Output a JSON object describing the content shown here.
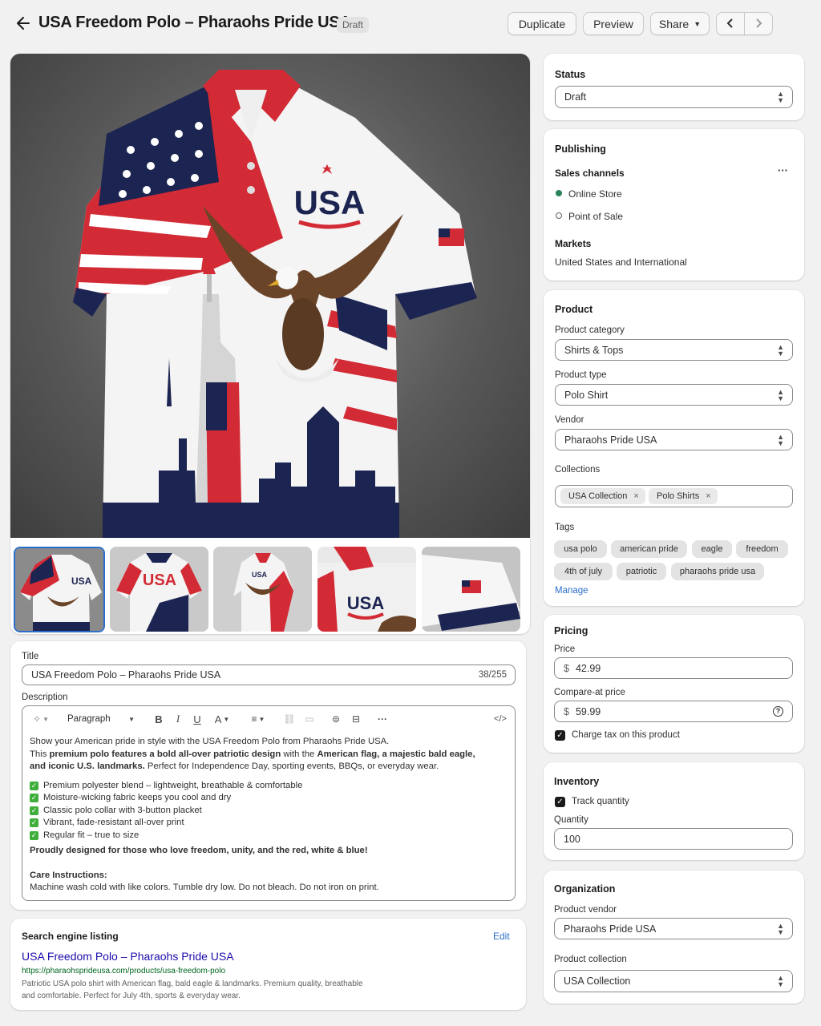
{
  "header": {
    "title": "USA Freedom Polo – Pharaohs Pride USA",
    "badge": "Draft",
    "duplicate": "Duplicate",
    "preview": "Preview",
    "share": "Share"
  },
  "gallery": {
    "alt": "USA"
  },
  "title_field": {
    "label": "Title",
    "value": "USA Freedom Polo – Pharaohs Pride USA",
    "counter": "38/255"
  },
  "description": {
    "label": "Description",
    "format": "Paragraph",
    "intro": "Show your American pride in style with the USA Freedom Polo from Pharaohs Pride USA.",
    "l2a": "This ",
    "l2b": "premium polo features a bold all-over patriotic design",
    "l2c": " with the ",
    "l2d": "American flag, a majestic bald eagle,",
    "l3a": "and iconic U.S. landmarks.",
    "l3b": " Perfect for Independence Day, sporting events, BBQs, or everyday wear.",
    "bullets": [
      "Premium polyester blend – lightweight, breathable & comfortable",
      "Moisture-wicking fabric keeps you cool and dry",
      "Classic polo collar with 3-button placket",
      "Vibrant, fade-resistant all-over print",
      "Regular fit – true to size"
    ],
    "closing": "Proudly designed for those who love freedom, unity, and the red, white & blue!",
    "care_title": "Care Instructions:",
    "care_text": "Machine wash cold with like colors. Tumble dry low. Do not bleach. Do not iron on print."
  },
  "seo": {
    "heading": "Search engine listing",
    "edit": "Edit",
    "title": "USA Freedom Polo – Pharaohs Pride USA",
    "url": "https://pharaohsprideusa.com/products/usa-freedom-polo",
    "desc1": "Patriotic USA polo shirt with American flag, bald eagle & landmarks. Premium quality, breathable",
    "desc2": "and comfortable. Perfect for July 4th, sports & everyday wear."
  },
  "status": {
    "heading": "Status",
    "value": "Draft"
  },
  "publishing": {
    "heading": "Publishing",
    "sales_channels": "Sales channels",
    "more": "···",
    "channels": [
      "Online Store",
      "Point of Sale"
    ],
    "markets_label": "Markets",
    "markets_value": "United States and International"
  },
  "product": {
    "heading": "Product",
    "category_label": "Product category",
    "category": "Shirts & Tops",
    "type_label": "Product type",
    "type": "Polo Shirt",
    "vendor_label": "Vendor",
    "vendor": "Pharaohs Pride USA",
    "collections_label": "Collections",
    "collections": [
      "USA Collection",
      "Polo Shirts"
    ],
    "tags_label": "Tags",
    "tags": [
      "usa polo",
      "american pride",
      "eagle",
      "freedom",
      "4th of july",
      "patriotic",
      "pharaohs pride usa"
    ],
    "manage": "Manage"
  },
  "pricing": {
    "heading": "Pricing",
    "price_label": "Price",
    "currency": "$",
    "price": "42.99",
    "compare_label": "Compare-at price",
    "compare": "59.99",
    "charge_tax": "Charge tax on this product"
  },
  "inventory": {
    "heading": "Inventory",
    "track": "Track quantity",
    "qty_label": "Quantity",
    "qty": "100"
  },
  "organization": {
    "heading": "Organization",
    "vendor_label": "Product vendor",
    "vendor": "Pharaohs Pride USA",
    "collection_label": "Product collection",
    "collection": "USA Collection"
  },
  "colors": {
    "accent": "#1a1a1a",
    "link": "#2c6ecb",
    "seo_title": "#1a0dab",
    "seo_url": "#006621",
    "online": "#29845a",
    "flag_red": "#d32b35",
    "flag_navy": "#1c2451"
  }
}
